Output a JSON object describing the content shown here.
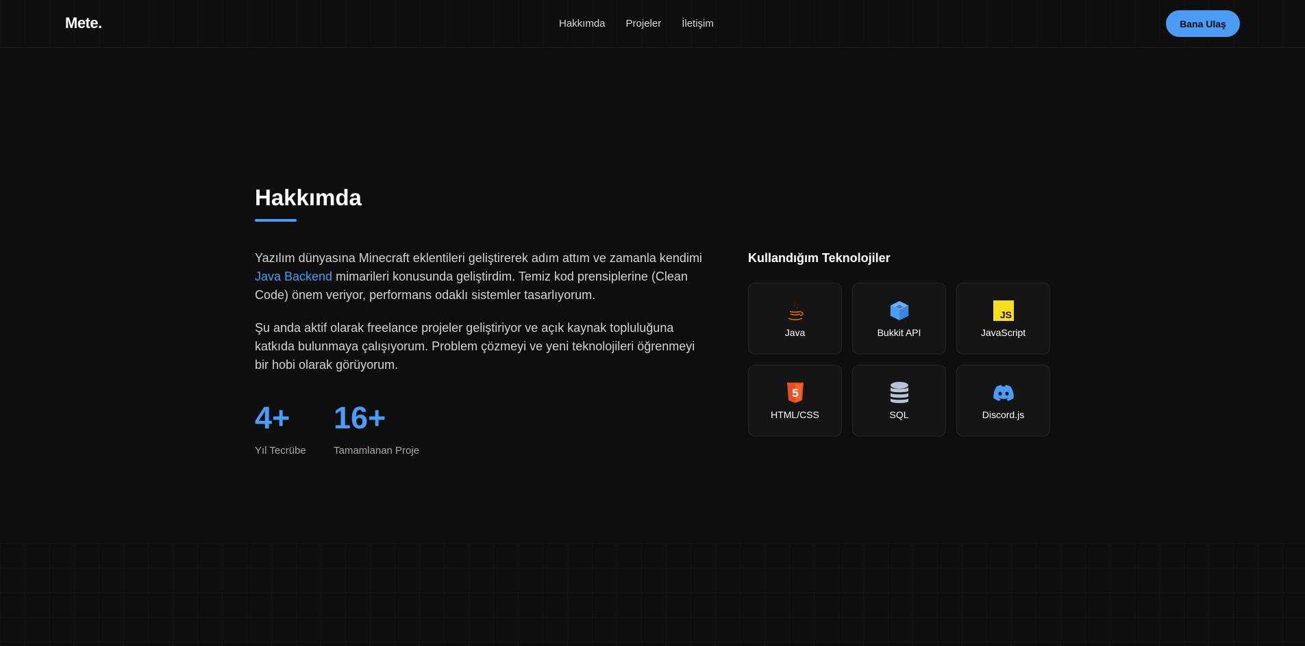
{
  "header": {
    "logo": "Mete.",
    "nav": [
      {
        "label": "Hakkımda"
      },
      {
        "label": "Projeler"
      },
      {
        "label": "İletişim"
      }
    ],
    "cta_label": "Bana Ulaş"
  },
  "about": {
    "title": "Hakkımda",
    "paragraph1_before": "Yazılım dünyasına Minecraft eklentileri geliştirerek adım attım ve zamanla kendimi ",
    "paragraph1_highlight": "Java Backend",
    "paragraph1_after": " mimarileri konusunda geliştirdim. Temiz kod prensiplerine (Clean Code) önem veriyor, performans odaklı sistemler tasarlıyorum.",
    "paragraph2": "Şu anda aktif olarak freelance projeler geliştiriyor ve açık kaynak topluluğuna katkıda bulunmaya çalışıyorum. Problem çözmeyi ve yeni teknolojileri öğrenmeyi bir hobi olarak görüyorum.",
    "stats": [
      {
        "value": "4+",
        "label": "Yıl Tecrübe"
      },
      {
        "value": "16+",
        "label": "Tamamlanan Proje"
      }
    ]
  },
  "tech": {
    "title": "Kullandığım Teknolojiler",
    "items": [
      {
        "label": "Java",
        "icon": "java-icon"
      },
      {
        "label": "Bukkit API",
        "icon": "cube-icon"
      },
      {
        "label": "JavaScript",
        "icon": "javascript-icon"
      },
      {
        "label": "HTML/CSS",
        "icon": "html5-icon"
      },
      {
        "label": "SQL",
        "icon": "database-icon"
      },
      {
        "label": "Discord.js",
        "icon": "discord-icon"
      }
    ],
    "js_badge": "JS",
    "html_badge": "5"
  },
  "colors": {
    "accent": "#4c9cf5",
    "background": "#0e0e0f",
    "java": "#e76f00",
    "javascript": "#f7df1e",
    "html": "#e44d26",
    "sql": "#b8c4d6",
    "discord": "#5865f2"
  }
}
